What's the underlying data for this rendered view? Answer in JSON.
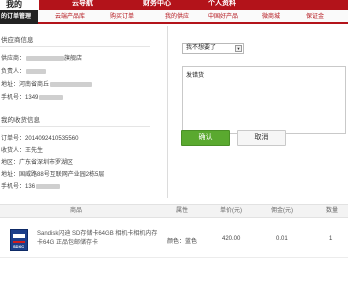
{
  "topnav": {
    "logo_label": "我的",
    "items": [
      "云导航",
      "财务中心",
      "个人资料"
    ]
  },
  "subnav": {
    "active": "的订单管理",
    "links": [
      "云端产品库",
      "购买订单",
      "我的供应",
      "中国好产品",
      "微商城",
      "保证金"
    ]
  },
  "supplier": {
    "title": "供应商信息",
    "shop_label": "供应商：",
    "shop_suffix": "旗舰店",
    "contact_label": "负责人：",
    "address_label": "地址：",
    "address_value": "河南省商丘",
    "phone_label": "手机号：",
    "phone_value": "1349"
  },
  "receiver": {
    "title": "我的收货信息",
    "order_label": "订单号：",
    "order_value": "2014092410535560",
    "name_label": "收货人：",
    "name_value": "王先生",
    "region_label": "地区：",
    "region_value": "广东省深圳市罗湖区",
    "address_label": "地址：",
    "address_value": "国威路88号互联网产业园2栋5层",
    "phone_label": "手机号：",
    "phone_value": "136"
  },
  "form": {
    "select_value": "我不想要了",
    "textarea_value": "发错货",
    "confirm_label": "确认",
    "cancel_label": "取消"
  },
  "table": {
    "headers": [
      "商品",
      "属性",
      "单价(元)",
      "佣金(元)",
      "数量"
    ],
    "rows": [
      {
        "name": "Sandisk闪迪 SD存储卡64GB 相机卡相机内存卡64G 正品包邮储存卡",
        "attr": "颜色：蓝色",
        "price": "420.00",
        "commission": "0.01",
        "qty": "1",
        "thumb_text": "SDXC"
      }
    ]
  }
}
